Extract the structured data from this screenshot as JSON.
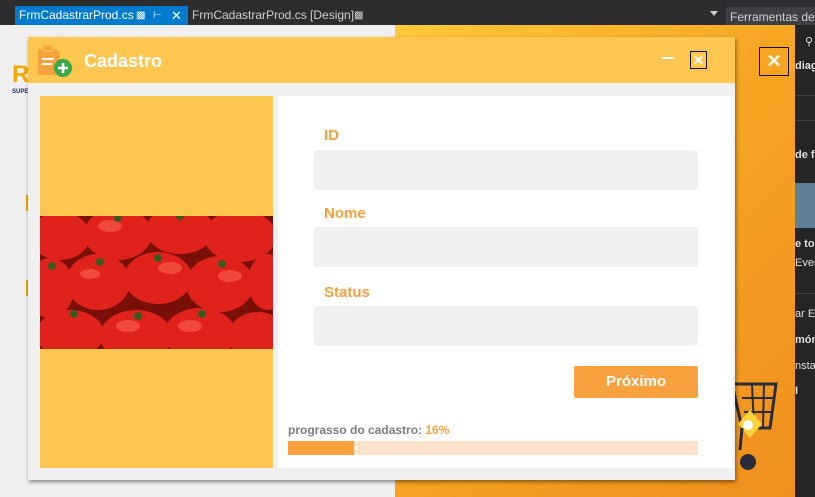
{
  "ide": {
    "tabs": [
      {
        "label": "FrmCadastrarProd.cs",
        "active": true
      },
      {
        "label": "FrmCadastrarProd.cs [Design]",
        "active": false
      }
    ],
    "tools_box": "Ferramentas de",
    "properties_fragments": [
      "diag",
      "de f",
      "e to",
      "Even",
      "ar Ev",
      "mór",
      "nsta"
    ]
  },
  "dialog": {
    "title": "Cadastro",
    "fields": [
      {
        "label": "ID",
        "value": "",
        "placeholder": ""
      },
      {
        "label": "Nome",
        "value": "",
        "placeholder": ""
      },
      {
        "label": "Status",
        "value": "",
        "placeholder": ""
      }
    ],
    "next_button": "Próximo",
    "progress_label": "prograsso do cadastro:",
    "progress_value_text": "16%",
    "progress_fraction": 0.16
  },
  "colors": {
    "title_bar": "#fdc651",
    "accent_orange": "#f7a13f",
    "progress_track": "#fde2cc",
    "vs_blue": "#007acc"
  },
  "icons": [
    "pin-icon",
    "close-icon",
    "minimize-icon",
    "add-document-icon",
    "tomato-image",
    "cart-icon",
    "handshake-icon",
    "search-icon"
  ]
}
